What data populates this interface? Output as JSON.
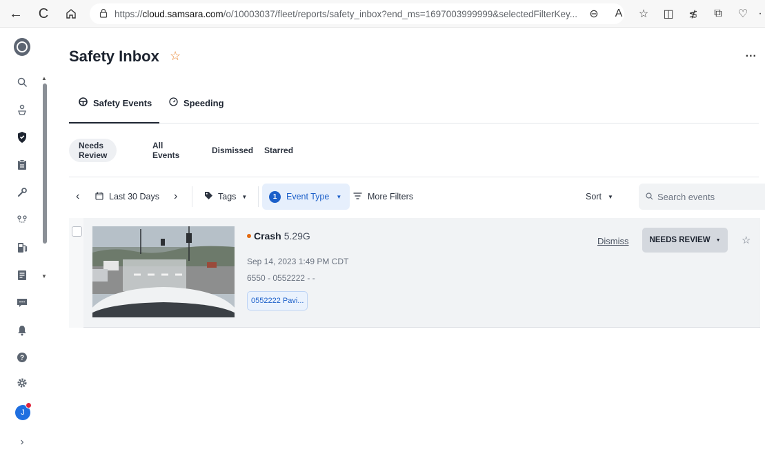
{
  "browser": {
    "url_prefix": "https://",
    "url_host": "cloud.samsara.com",
    "url_path": "/o/10003037/fleet/reports/safety_inbox?end_ms=1697003999999&selectedFilterKey..."
  },
  "page": {
    "title": "Safety Inbox",
    "more_menu": "..."
  },
  "tabs": [
    {
      "label": "Safety Events",
      "icon": "steering-wheel-icon",
      "active": true
    },
    {
      "label": "Speeding",
      "icon": "speedometer-icon",
      "active": false
    }
  ],
  "subtabs": [
    {
      "label": "Needs Review",
      "active": true
    },
    {
      "label": "All Events",
      "active": false
    },
    {
      "label": "Dismissed",
      "active": false
    },
    {
      "label": "Starred",
      "active": false
    }
  ],
  "filters": {
    "date_range": "Last 30 Days",
    "tags": "Tags",
    "event_type_count": "1",
    "event_type": "Event Type",
    "more_filters": "More Filters",
    "sort": "Sort",
    "search_placeholder": "Search events"
  },
  "events": [
    {
      "type": "Crash",
      "gforce": "5.29G",
      "timestamp": "Sep 14, 2023 1:49 PM CDT",
      "vehicle": "6550 - 0552222 - -",
      "tag_chip": "0552222 Pavi...",
      "dismiss_label": "Dismiss",
      "status_label": "NEEDS REVIEW",
      "severity_color": "#e36a10"
    }
  ],
  "colors": {
    "accent_blue": "#1b5fc9",
    "title_star": "#e9822a",
    "notification_dot": "#e0243d"
  },
  "user": {
    "initial": "J"
  }
}
